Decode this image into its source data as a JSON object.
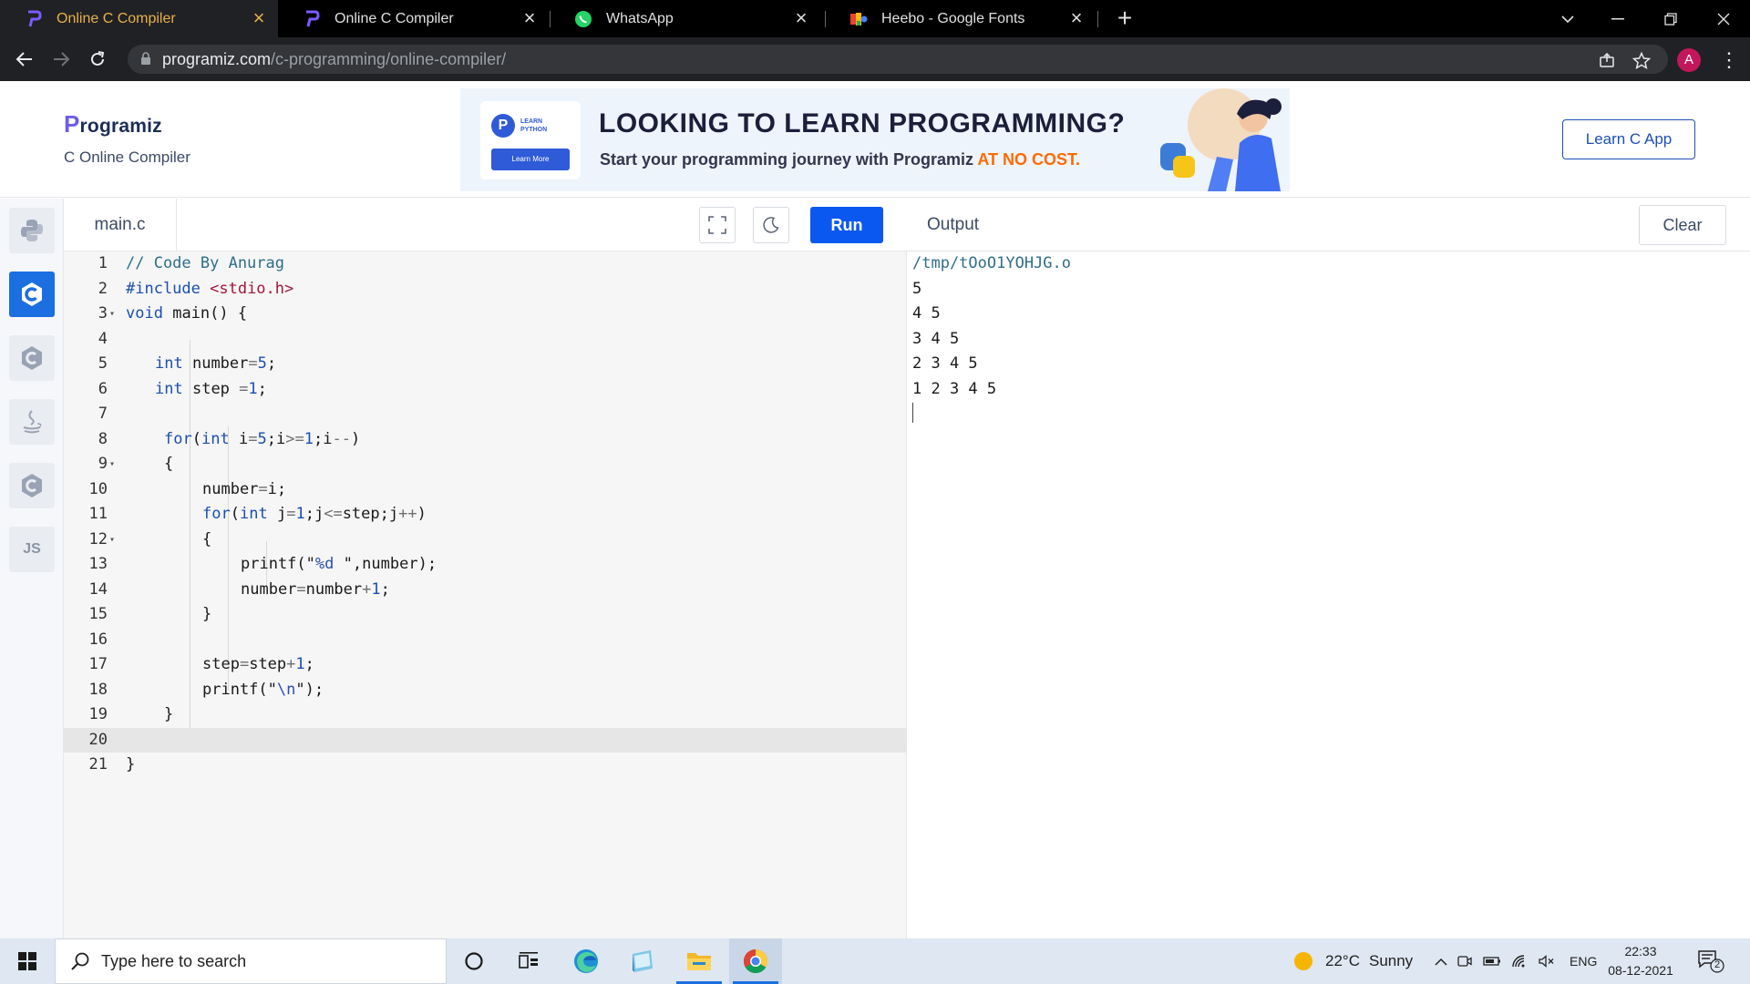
{
  "browser": {
    "tabs": [
      {
        "title": "Online C Compiler",
        "icon": "programiz-favicon",
        "active": true
      },
      {
        "title": "Online C Compiler",
        "icon": "programiz-favicon",
        "active": false
      },
      {
        "title": "WhatsApp",
        "icon": "whatsapp-favicon",
        "active": false
      },
      {
        "title": "Heebo - Google Fonts",
        "icon": "google-fonts-favicon",
        "active": false
      }
    ],
    "url_host": "programiz.com",
    "url_path": "/c-programming/online-compiler/",
    "profile_initial": "A"
  },
  "header": {
    "logo_text": "rogramiz",
    "logo_initial": "P",
    "subtitle": "C Online Compiler",
    "learn_app_label": "Learn C App"
  },
  "banner": {
    "badge_top": "LEARN",
    "badge_bottom": "PYTHON",
    "badge_button": "Learn More",
    "headline": "LOOKING TO LEARN PROGRAMMING?",
    "subline": "Start your programming journey with Programiz ",
    "highlight": "AT NO COST."
  },
  "rail": {
    "languages": [
      "python-icon",
      "c-icon",
      "cpp-icon",
      "java-icon",
      "csharp-icon",
      "js-icon"
    ],
    "js_label": "JS"
  },
  "editor": {
    "filename": "main.c",
    "run_label": "Run",
    "active_line": 20,
    "lines": [
      {
        "n": "1",
        "text": "// Code By Anurag"
      },
      {
        "n": "2",
        "text": "#include <stdio.h>"
      },
      {
        "n": "3",
        "text": "void main() {"
      },
      {
        "n": "4",
        "text": ""
      },
      {
        "n": "5",
        "text": "int number=5;"
      },
      {
        "n": "6",
        "text": "int step =1;"
      },
      {
        "n": "7",
        "text": ""
      },
      {
        "n": "8",
        "text": "for(int i=5;i>=1;i--)"
      },
      {
        "n": "9",
        "text": "{"
      },
      {
        "n": "10",
        "text": "number=i;"
      },
      {
        "n": "11",
        "text": "for(int j=1;j<=step;j++)"
      },
      {
        "n": "12",
        "text": "{"
      },
      {
        "n": "13",
        "text": "printf(\"%d \",number);"
      },
      {
        "n": "14",
        "text": "number=number+1;"
      },
      {
        "n": "15",
        "text": "}"
      },
      {
        "n": "16",
        "text": ""
      },
      {
        "n": "17",
        "text": "step=step+1;"
      },
      {
        "n": "18",
        "text": "printf(\"\\n\");"
      },
      {
        "n": "19",
        "text": "}"
      },
      {
        "n": "20",
        "text": ""
      },
      {
        "n": "21",
        "text": "}"
      }
    ]
  },
  "output": {
    "title": "Output",
    "clear_label": "Clear",
    "lines": [
      "/tmp/tOoO1YOHJG.o",
      "5",
      "4 5",
      "3 4 5",
      "2 3 4 5",
      "1 2 3 4 5"
    ]
  },
  "taskbar": {
    "search_placeholder": "Type here to search",
    "weather_temp": "22°C",
    "weather_text": "Sunny",
    "lang": "ENG",
    "time": "22:33",
    "date": "08-12-2021",
    "notification_count": "2"
  }
}
